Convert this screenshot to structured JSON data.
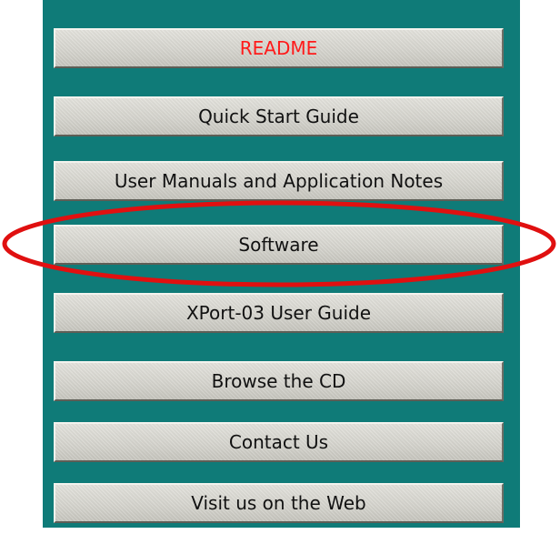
{
  "menu": {
    "buttons": [
      {
        "label": "README",
        "color": "#ff1a1a"
      },
      {
        "label": "Quick Start Guide"
      },
      {
        "label": "User Manuals and Application Notes"
      },
      {
        "label": "Software"
      },
      {
        "label": "XPort-03 User Guide"
      },
      {
        "label": "Browse the CD"
      },
      {
        "label": "Contact Us"
      },
      {
        "label": "Visit us on the Web"
      }
    ]
  },
  "colors": {
    "panel_background": "#0f7b78",
    "button_face": "#d7d6cf",
    "highlight_ellipse": "#e01010"
  },
  "highlighted_item": "Software"
}
